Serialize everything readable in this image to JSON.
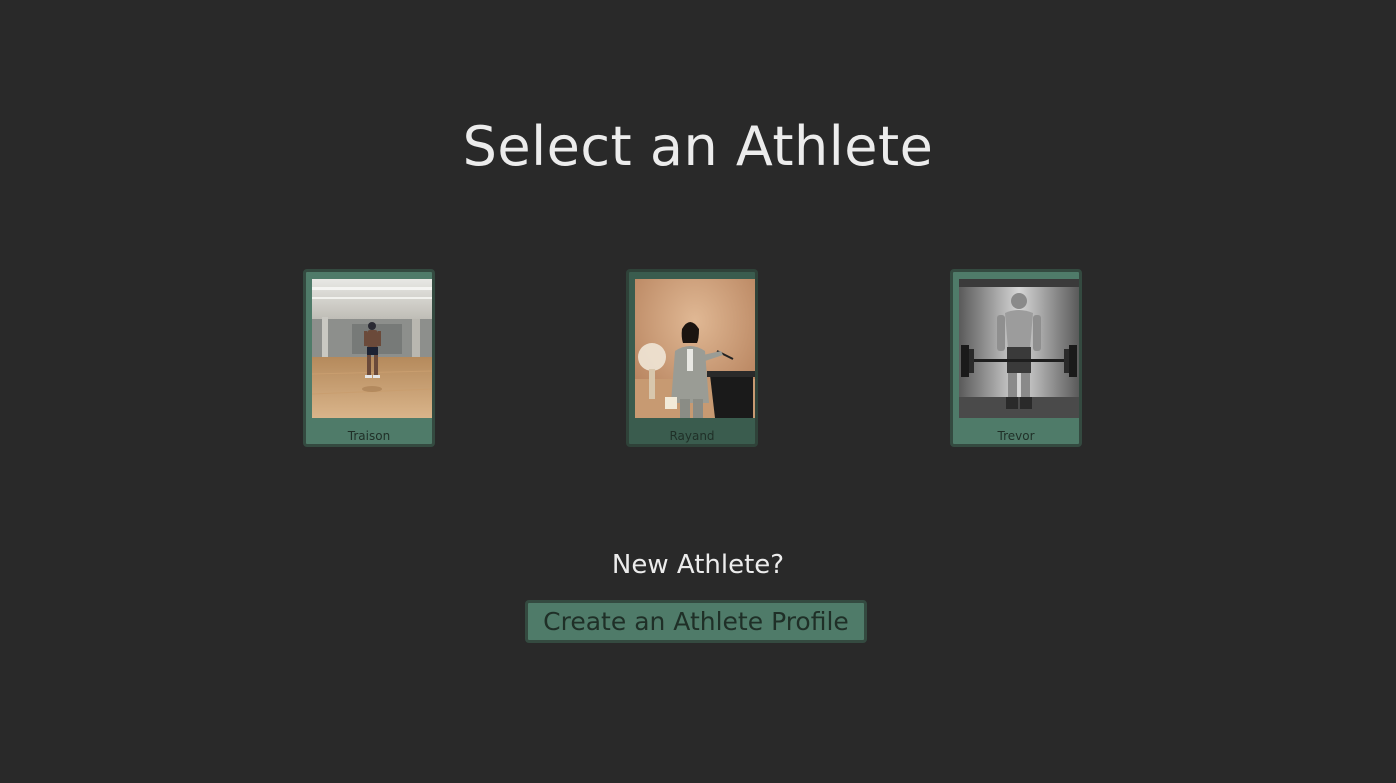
{
  "page": {
    "title": "Select an Athlete"
  },
  "athletes": [
    {
      "name": "Traison",
      "photo_icon": "athlete-photo-gym-floor"
    },
    {
      "name": "Rayand",
      "photo_icon": "athlete-photo-podium-speaker"
    },
    {
      "name": "Trevor",
      "photo_icon": "athlete-photo-barbell-bw"
    }
  ],
  "new_athlete": {
    "prompt": "New Athlete?",
    "button_label": "Create an Athlete Profile"
  },
  "colors": {
    "background": "#292929",
    "card": "#4f7b69",
    "card_selected": "#3a5c4e",
    "border": "#344a40",
    "text_light": "#ececec"
  }
}
